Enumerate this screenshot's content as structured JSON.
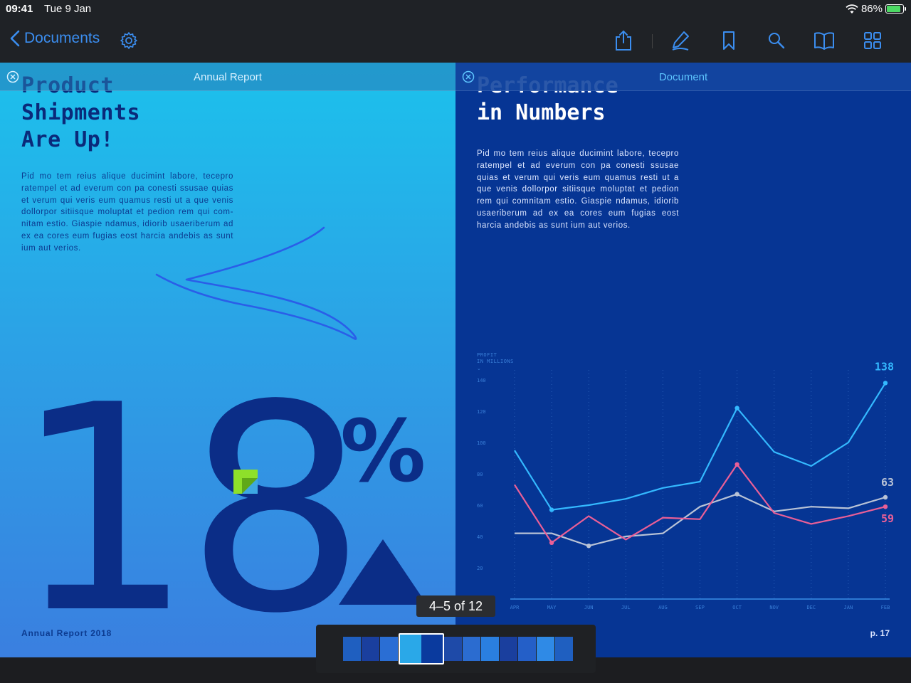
{
  "status_bar": {
    "time": "09:41",
    "date": "Tue 9 Jan",
    "battery": "86%",
    "battery_level": 0.86
  },
  "toolbar": {
    "back_label": "Documents",
    "icons": [
      "chevron-left-icon",
      "gear-icon",
      "share-icon",
      "pen-icon",
      "bookmark-icon",
      "search-icon",
      "book-icon",
      "grid-icon"
    ]
  },
  "left_page": {
    "header_title": "Annual Report",
    "heading_cut": "Product",
    "heading_lines": [
      "Shipments",
      "Are Up!"
    ],
    "body": "Pid mo tem reius alique ducimint labore, tecepro ratempel et ad everum con pa conesti ssusae quias et verum qui veris eum quamus resti ut a que venis dollorpor sitiisque moluptat et pedion rem qui com-nitam estio. Giaspie ndamus, idiorib usaeriberum ad ex ea cores eum fugias eost harcia andebis as sunt ium aut verios.",
    "big_number": "18",
    "big_symbol": "%",
    "footer": "Annual Report 2018"
  },
  "right_page": {
    "header_title": "Document",
    "heading_cut": "Performance",
    "heading_line": "in Numbers",
    "body": "Pid mo tem reius alique ducimint labore, tecepro ratempel et ad everum con pa conesti ssusae quias et verum qui veris eum quamus resti ut a que venis dollorpor sitiisque moluptat et pedion rem qui comnitam estio. Giaspie ndamus, idiorib usaeriberum ad ex ea cores eum fugias eost harcia andebis as sunt ium aut verios.",
    "footer": "p. 17"
  },
  "chart_data": {
    "type": "line",
    "ylabel": "PROFIT IN MILLIONS",
    "categories": [
      "APR",
      "MAY",
      "JUN",
      "JUL",
      "AUG",
      "SEP",
      "OCT",
      "NOV",
      "DEC",
      "JAN",
      "FEB"
    ],
    "yticks": [
      0,
      20,
      40,
      60,
      80,
      100,
      120,
      140
    ],
    "ylim": [
      0,
      140
    ],
    "grid": true,
    "series": [
      {
        "color": "#34b9ff",
        "end_label": "138",
        "values": [
          95,
          57,
          60,
          64,
          71,
          75,
          122,
          94,
          85,
          100,
          138
        ]
      },
      {
        "color": "#b9c3d6",
        "end_label": "63",
        "values": [
          42,
          42,
          34,
          40,
          42,
          59,
          67,
          56,
          59,
          58,
          65
        ]
      },
      {
        "color": "#ea5f97",
        "end_label": "59",
        "values": [
          73,
          36,
          53,
          38,
          52,
          51,
          86,
          55,
          48,
          53,
          59
        ]
      }
    ]
  },
  "page_indicator": "4–5 of 12",
  "thumbnails": {
    "count": 12,
    "current_pages": [
      4,
      5
    ]
  }
}
